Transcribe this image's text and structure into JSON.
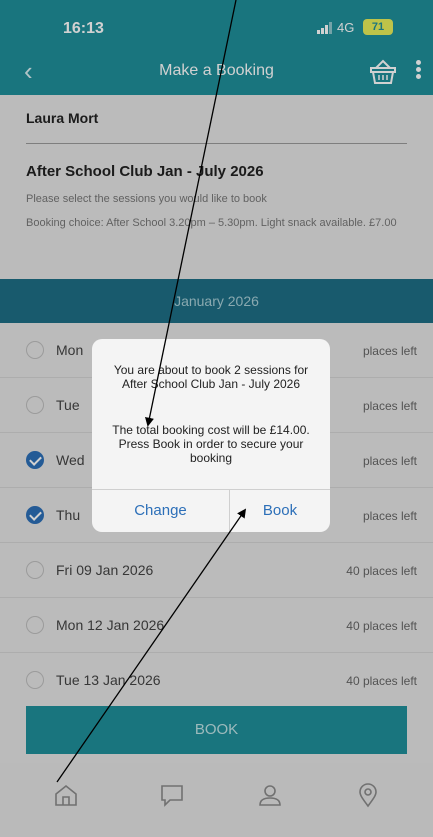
{
  "status": {
    "time": "16:13",
    "network": "4G",
    "battery": "71"
  },
  "nav": {
    "title": "Make a Booking"
  },
  "booking": {
    "child_name": "Laura Mort",
    "club_title": "After School Club Jan - July 2026",
    "instruction": "Please select the sessions you would like to book",
    "choice": "Booking choice: After School 3.20pm – 5.30pm. Light snack available. £7.00",
    "month": "January 2026"
  },
  "sessions": [
    {
      "date": "Mon",
      "places": "places left",
      "checked": false
    },
    {
      "date": "Tue",
      "places": "places left",
      "checked": false
    },
    {
      "date": "Wed",
      "places": "places left",
      "checked": true
    },
    {
      "date": "Thu",
      "places": "places left",
      "checked": true
    },
    {
      "date": "Fri 09 Jan 2026",
      "places": "40 places left",
      "checked": false
    },
    {
      "date": "Mon 12 Jan 2026",
      "places": "40 places left",
      "checked": false
    },
    {
      "date": "Tue 13 Jan 2026",
      "places": "40 places left",
      "checked": false
    }
  ],
  "book_button": "BOOK",
  "dialog": {
    "message": "You are about to book 2 sessions for After School Club Jan - July 2026",
    "cost_message": "The total booking cost will be £14.00. Press Book in order to secure your booking",
    "change_label": "Change",
    "book_label": "Book"
  },
  "tabs": [
    {
      "icon": "home-icon"
    },
    {
      "icon": "chat-icon"
    },
    {
      "icon": "profile-icon"
    },
    {
      "icon": "location-pin-icon"
    }
  ],
  "colors": {
    "header": "#1f8f9a",
    "month_bar": "#1e6e86",
    "accent_blue": "#2c6fb8"
  }
}
